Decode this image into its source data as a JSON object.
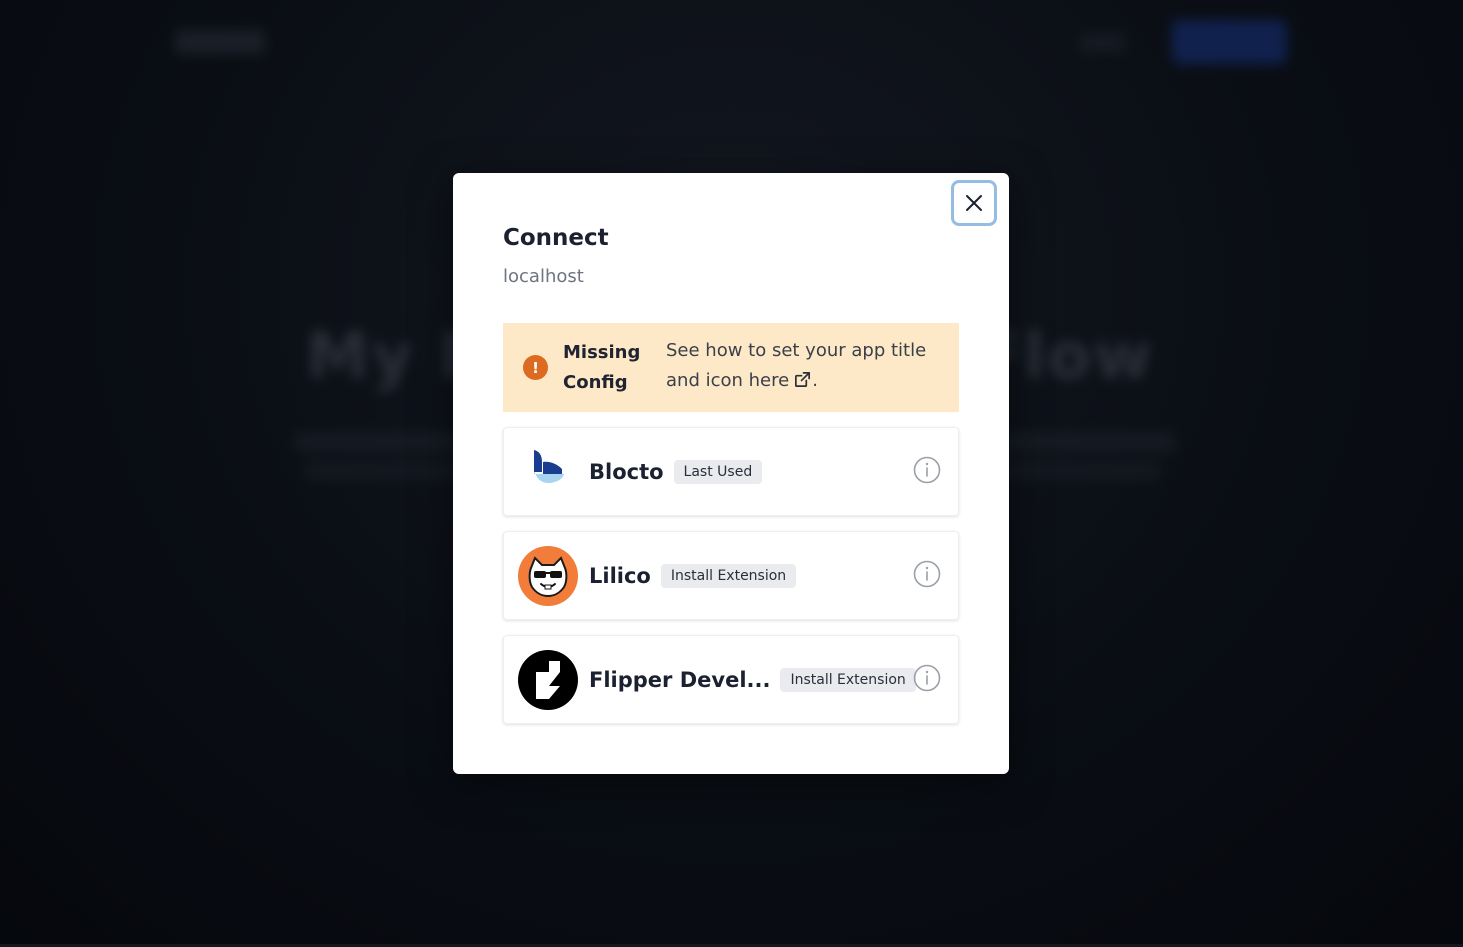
{
  "background": {
    "hero_title": "My First Dapp on Flow"
  },
  "modal": {
    "title": "Connect",
    "subtitle": "localhost",
    "notice": {
      "icon": "exclamation-icon",
      "title": "Missing Config",
      "text": "See how to set your app title and icon here",
      "suffix": ".",
      "link_icon": "external-link-icon",
      "color": "#fde9c7",
      "icon_color": "#dd6a21"
    },
    "close_icon": "close-icon",
    "wallets": [
      {
        "name": "Blocto",
        "badge": "Last Used",
        "logo": "blocto-logo"
      },
      {
        "name": "Lilico",
        "badge": "Install Extension",
        "logo": "lilico-logo"
      },
      {
        "name": "Flipper Devel...",
        "badge": "Install Extension",
        "logo": "flipper-logo"
      }
    ]
  },
  "colors": {
    "accent_focus": "#95bde4",
    "lilico_orange": "#f27d3a",
    "blocto_dark": "#1b3d8f",
    "blocto_light": "#a8d4f2"
  }
}
